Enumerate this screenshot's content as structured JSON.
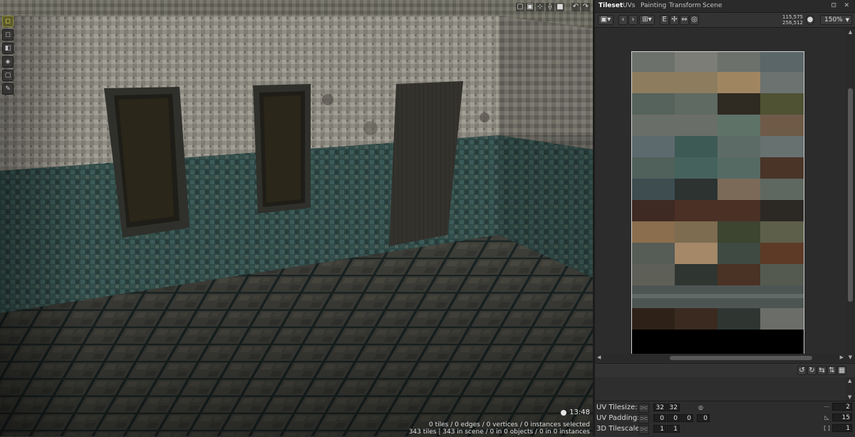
{
  "tabs": [
    {
      "label": "Tileset",
      "active": true
    },
    {
      "label": "UVs",
      "active": false
    },
    {
      "label": "Painting",
      "active": false
    },
    {
      "label": "Transform",
      "active": false
    },
    {
      "label": "Scene",
      "active": false
    }
  ],
  "panel_window_buttons": {
    "maximize": "⊡",
    "close": "✕"
  },
  "tileset_toolbar": {
    "coord_line1": "115,575",
    "coord_line2": "256,512",
    "zoom": "150%",
    "icons": [
      "image-icon",
      "prev-icon",
      "next-icon",
      "grid-icon",
      "e-icon",
      "move-icon",
      "flip-icon",
      "target-icon"
    ]
  },
  "tile_tools": {
    "icons": [
      "rotate-ccw-icon",
      "rotate-cw-icon",
      "flip-h-icon",
      "flip-v-icon",
      "grid-view-icon"
    ]
  },
  "viewport": {
    "clock": "13:48",
    "status_line1": "0 tiles / 0 edges / 0 vertices / 0 instances selected",
    "status_line2": "343 tiles | 343 in scene / 0 in 0 objects / 0 in 0 instances",
    "left_tools": [
      "select-icon",
      "box-icon",
      "cube-icon",
      "paint-icon",
      "square-icon",
      "pencil-icon"
    ],
    "view_tools": [
      "frame-icon",
      "wireframe-icon",
      "axis-icon",
      "snap-icon",
      "stop-icon",
      "undo-icon",
      "redo-icon"
    ]
  },
  "properties": {
    "uv_tilesize": {
      "label": "UV Tilesize:",
      "x": "32",
      "y": "32"
    },
    "uv_padding": {
      "label": "UV Padding:",
      "values": [
        "0",
        "0",
        "0",
        "0"
      ]
    },
    "tilescale_3d": {
      "label": "3D Tilescale:",
      "x": "1",
      "y": "1"
    },
    "right_values": [
      "2",
      "15",
      "1"
    ]
  },
  "colors": {
    "accent_tool": "#f4e95a",
    "panel_bg": "#2f2f2f",
    "input_bg": "#1f1f1f"
  }
}
